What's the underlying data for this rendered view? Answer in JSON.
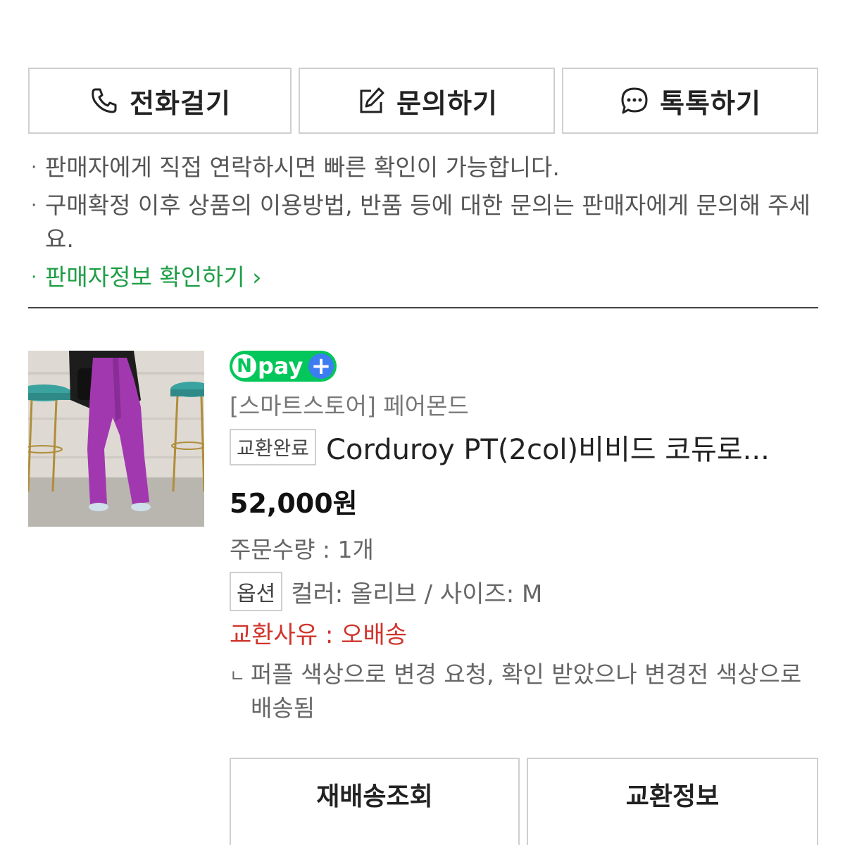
{
  "contact_buttons": {
    "call_label": "전화걸기",
    "inquiry_label": "문의하기",
    "talk_label": "톡톡하기",
    "call_icon": "phone-icon",
    "inquiry_icon": "edit-icon",
    "talk_icon": "chat-bubble-icon"
  },
  "notes": [
    "판매자에게 직접 연락하시면 빠른 확인이 가능합니다.",
    "구매확정 이후 상품의 이용방법, 반품 등에 대한 문의는 판매자에게 문의해 주세요."
  ],
  "seller_link": "판매자정보 확인하기",
  "order": {
    "npay_badge": "pay",
    "npay_n": "N",
    "npay_plus": "+",
    "store": "[스마트스토어] 페어몬드",
    "status_tag": "교환완료",
    "product_name": "Corduroy PT(2col)비비드 코듀로...",
    "price": "52,000원",
    "quantity": "주문수량 : 1개",
    "option_tag": "옵션",
    "option_value": "컬러: 올리브 / 사이즈: M",
    "exchange_reason": "교환사유 : 오배송",
    "exchange_detail": "퍼플 색상으로 변경 요청, 확인 받았으나 변경전 색상으로 배송됨"
  },
  "bottom_buttons": {
    "reship_label": "재배송조회",
    "exchange_label": "교환정보"
  },
  "colors": {
    "accent_green": "#1e9e46",
    "npay_green": "#03c75a",
    "alert_red": "#d0342c",
    "border": "#cfcfcf"
  }
}
